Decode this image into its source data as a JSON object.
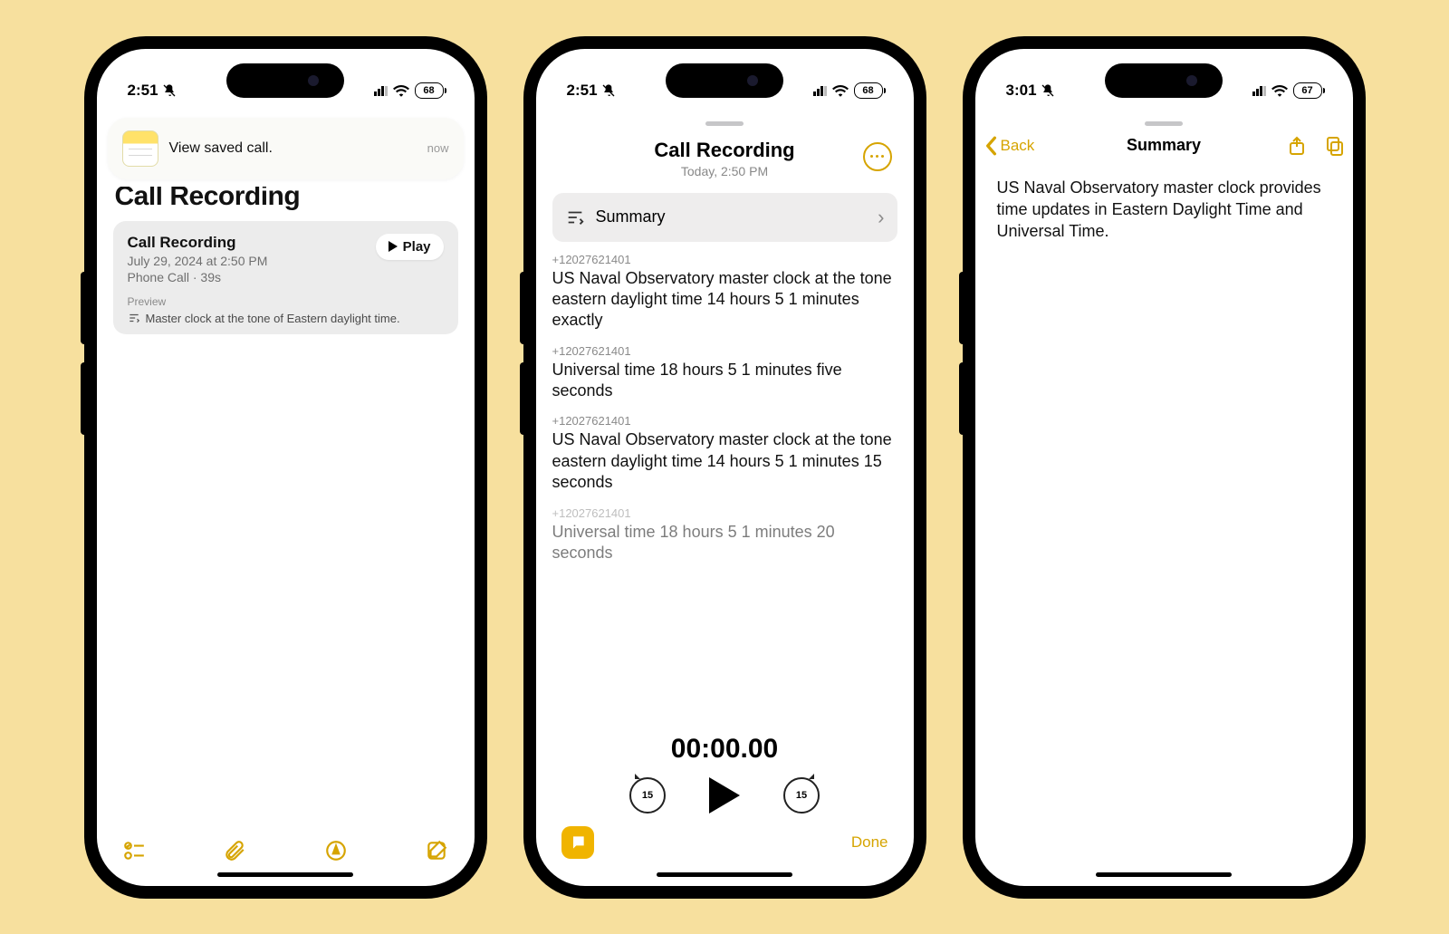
{
  "status": {
    "time1": "2:51",
    "time2": "2:51",
    "time3": "3:01",
    "battery12": "68",
    "battery3": "67"
  },
  "p1": {
    "notif_title": "View saved call.",
    "notif_when": "now",
    "big_title": "Call Recording",
    "card_title": "Call Recording",
    "card_date": "July 29, 2024 at 2:50 PM",
    "card_type": "Phone Call · 39s",
    "play_label": "Play",
    "preview_label": "Preview",
    "preview_text": "Master clock at the tone of Eastern daylight time."
  },
  "p2": {
    "title": "Call Recording",
    "subtitle": "Today, 2:50 PM",
    "summary_label": "Summary",
    "transcript": [
      {
        "num": "+12027621401",
        "text": "US Naval Observatory master clock at the tone eastern daylight time 14 hours 5 1 minutes exactly",
        "fade": false
      },
      {
        "num": "+12027621401",
        "text": "Universal time 18 hours 5 1 minutes five seconds",
        "fade": false
      },
      {
        "num": "+12027621401",
        "text": "US Naval Observatory master clock at the tone eastern daylight time 14 hours 5 1 minutes 15 seconds",
        "fade": false
      },
      {
        "num": "+12027621401",
        "text": "Universal time 18 hours 5 1 minutes 20 seconds",
        "fade": true
      }
    ],
    "timecode": "00:00.00",
    "skip_amount": "15",
    "done": "Done"
  },
  "p3": {
    "back": "Back",
    "title": "Summary",
    "body": "US Naval Observatory master clock provides time updates in Eastern Daylight Time and Universal Time."
  }
}
